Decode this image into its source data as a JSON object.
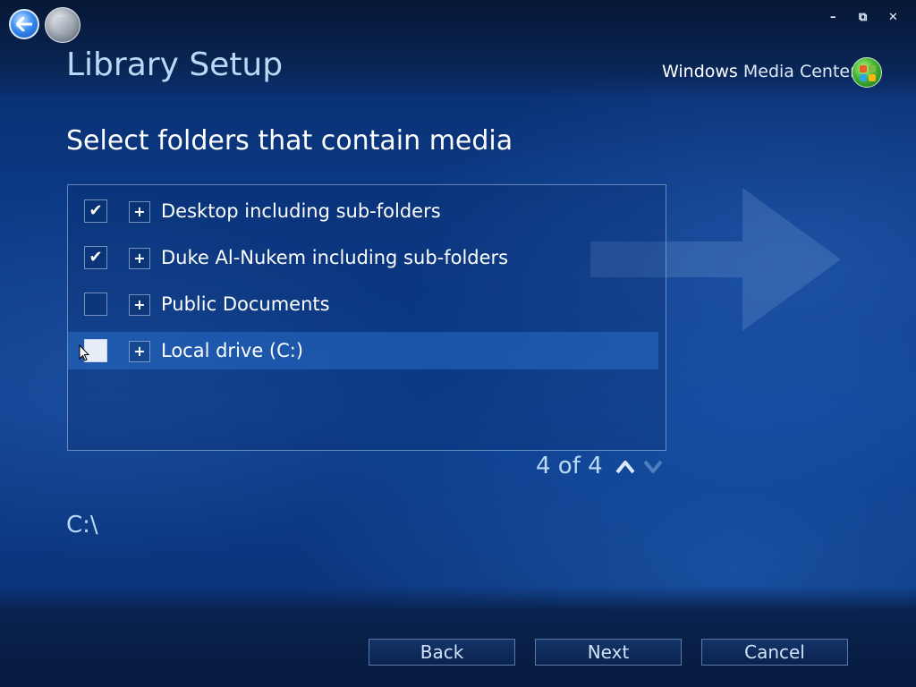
{
  "window": {
    "minimize": "–",
    "restore": "⧉",
    "close": "✕"
  },
  "header": {
    "title": "Library Setup",
    "brand_bold": "Windows",
    "brand_light": "Media Center"
  },
  "main": {
    "subtitle": "Select folders that contain media",
    "folders": [
      {
        "label": "Desktop including sub-folders",
        "checked": true,
        "check_glyph": "✔"
      },
      {
        "label": "Duke Al-Nukem including sub-folders",
        "checked": true,
        "check_glyph": "✔"
      },
      {
        "label": "Public Documents",
        "checked": false,
        "check_glyph": ""
      },
      {
        "label": "Local drive (C:)",
        "checked": false,
        "check_glyph": "",
        "selected": true
      }
    ],
    "expand_glyph": "+",
    "pager": "4 of 4",
    "current_path": "C:\\"
  },
  "footer": {
    "back_label": "Back",
    "next_label": "Next",
    "cancel_label": "Cancel"
  },
  "colors": {
    "title": "#b9daf7",
    "background": "#0b3a86",
    "selected_row": "#2a6ec8"
  }
}
